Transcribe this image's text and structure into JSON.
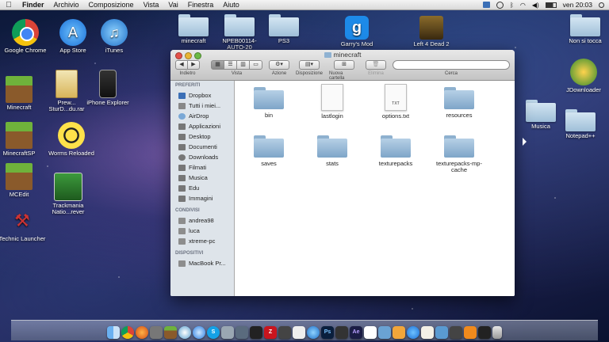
{
  "menubar": {
    "app": "Finder",
    "items": [
      "Archivio",
      "Composizione",
      "Vista",
      "Vai",
      "Finestra",
      "Aiuto"
    ],
    "clock": "ven 20:03"
  },
  "desktop": {
    "icons": [
      {
        "label": "Google Chrome",
        "name": "chrome-icon"
      },
      {
        "label": "App Store",
        "name": "appstore-icon"
      },
      {
        "label": "iTunes",
        "name": "itunes-icon"
      },
      {
        "label": "Minecraft",
        "name": "minecraft-icon"
      },
      {
        "label": "Prew... SturD...du.rar",
        "name": "rar-archive-icon"
      },
      {
        "label": "iPhone Explorer",
        "name": "iphone-explorer-icon"
      },
      {
        "label": "MinecraftSP",
        "name": "minecraftsp-icon"
      },
      {
        "label": "Worms Reloaded",
        "name": "worms-icon"
      },
      {
        "label": "MCEdit",
        "name": "mcedit-icon"
      },
      {
        "label": "Trackmania Natio...rever",
        "name": "trackmania-icon"
      },
      {
        "label": "Technic Launcher",
        "name": "technic-icon"
      },
      {
        "label": "minecraft",
        "name": "folder-icon"
      },
      {
        "label": "NPEB00114-AUTO-20",
        "name": "folder-icon"
      },
      {
        "label": "PS3",
        "name": "folder-icon"
      },
      {
        "label": "Garry's Mod",
        "name": "garrysmod-icon"
      },
      {
        "label": "Left 4 Dead 2",
        "name": "l4d2-icon"
      },
      {
        "label": "Non si tocca",
        "name": "folder-icon"
      },
      {
        "label": "JDownloader",
        "name": "jdownloader-icon"
      },
      {
        "label": "Musica",
        "name": "folder-icon"
      },
      {
        "label": "Notepad++",
        "name": "folder-icon"
      }
    ]
  },
  "window": {
    "title": "minecraft",
    "toolbar": {
      "back": "◀",
      "forward": "▶",
      "back_forward_label": "Indietro",
      "view_label": "Vista",
      "action_label": "Azione",
      "arrange_label": "Disposizione",
      "new_folder_label": "Nuova cartella",
      "delete_label": "Elimina",
      "search_label": "Cerca",
      "search_value": ""
    },
    "sidebar": {
      "sections": [
        {
          "title": "PREFERITI",
          "items": [
            "Dropbox",
            "Tutti i miei...",
            "AirDrop",
            "Applicazioni",
            "Desktop",
            "Documenti",
            "Downloads",
            "Filmati",
            "Musica",
            "Edu",
            "Immagini"
          ]
        },
        {
          "title": "CONDIVISI",
          "items": [
            "andrea98",
            "luca",
            "xtreme-pc"
          ]
        },
        {
          "title": "DISPOSITIVI",
          "items": [
            "MacBook Pr..."
          ]
        }
      ]
    },
    "files": [
      {
        "name": "bin",
        "kind": "folder"
      },
      {
        "name": "lastlogin",
        "kind": "doc",
        "tag": ""
      },
      {
        "name": "options.txt",
        "kind": "doc",
        "tag": "TXT"
      },
      {
        "name": "resources",
        "kind": "folder"
      },
      {
        "name": "saves",
        "kind": "folder"
      },
      {
        "name": "stats",
        "kind": "folder"
      },
      {
        "name": "texturepacks",
        "kind": "folder"
      },
      {
        "name": "texturepacks-mp-cache",
        "kind": "folder"
      }
    ]
  },
  "dock": {
    "items": [
      "finder",
      "chrome",
      "firefox",
      "tools",
      "minecraft",
      "photos",
      "safari",
      "skype",
      "mail",
      "xcode",
      "terminal",
      "filezilla",
      "video",
      "wireless",
      "itunes",
      "photoshop",
      "camera",
      "aftereffects",
      "ical",
      "preview",
      "garageband",
      "appstore",
      "textedit",
      "iphoto",
      "calculator",
      "vlc",
      "music",
      "trash"
    ]
  }
}
